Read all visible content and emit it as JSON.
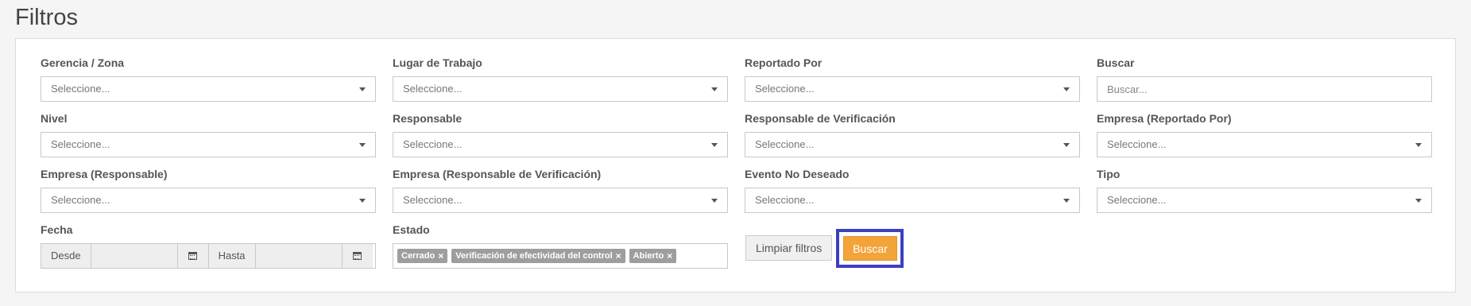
{
  "page_title": "Filtros",
  "filters": {
    "gerencia": {
      "label": "Gerencia / Zona",
      "value": "Seleccione..."
    },
    "lugar": {
      "label": "Lugar de Trabajo",
      "value": "Seleccione..."
    },
    "reportado_por": {
      "label": "Reportado Por",
      "value": "Seleccione..."
    },
    "buscar": {
      "label": "Buscar",
      "placeholder": "Buscar..."
    },
    "nivel": {
      "label": "Nivel",
      "value": "Seleccione..."
    },
    "responsable": {
      "label": "Responsable",
      "value": "Seleccione..."
    },
    "resp_verificacion": {
      "label": "Responsable de Verificación",
      "value": "Seleccione..."
    },
    "empresa_reportado": {
      "label": "Empresa (Reportado Por)",
      "value": "Seleccione..."
    },
    "empresa_responsable": {
      "label": "Empresa (Responsable)",
      "value": "Seleccione..."
    },
    "empresa_resp_verif": {
      "label": "Empresa (Responsable de Verificación)",
      "value": "Seleccione..."
    },
    "evento": {
      "label": "Evento No Deseado",
      "value": "Seleccione..."
    },
    "tipo": {
      "label": "Tipo",
      "value": "Seleccione..."
    },
    "fecha": {
      "label": "Fecha",
      "desde": "Desde",
      "hasta": "Hasta"
    },
    "estado": {
      "label": "Estado",
      "tags": [
        "Cerrado",
        "Verificación de efectividad del control",
        "Abierto"
      ]
    }
  },
  "buttons": {
    "clear": "Limpiar filtros",
    "search": "Buscar"
  },
  "colors": {
    "accent": "#f2a43a",
    "focus": "#3b3fc2",
    "tag": "#9e9e9e"
  }
}
